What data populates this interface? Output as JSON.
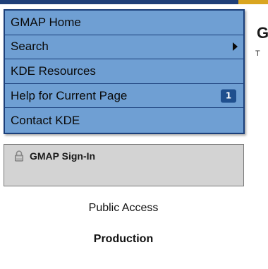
{
  "menu": {
    "items": [
      {
        "label": "GMAP Home"
      },
      {
        "label": "Search",
        "has_submenu": true,
        "submenu_icon": "triangle-right-icon"
      },
      {
        "label": "KDE Resources"
      },
      {
        "label": "Help for Current Page",
        "badge": "1"
      },
      {
        "label": "Contact KDE"
      }
    ]
  },
  "signin": {
    "label": "GMAP Sign-In",
    "icon": "lock-icon"
  },
  "access_label": "Public Access",
  "environment_label": "Production",
  "right_heading_partial": "G",
  "right_sub_partial": "T",
  "colors": {
    "menu_background": "#6f9fd3",
    "menu_border": "#1b3f7a",
    "badge_background": "#1f4f8e",
    "signin_panel_background": "#d3d3d3",
    "top_strip": "#1f3f78",
    "top_accent": "#d9a520"
  }
}
